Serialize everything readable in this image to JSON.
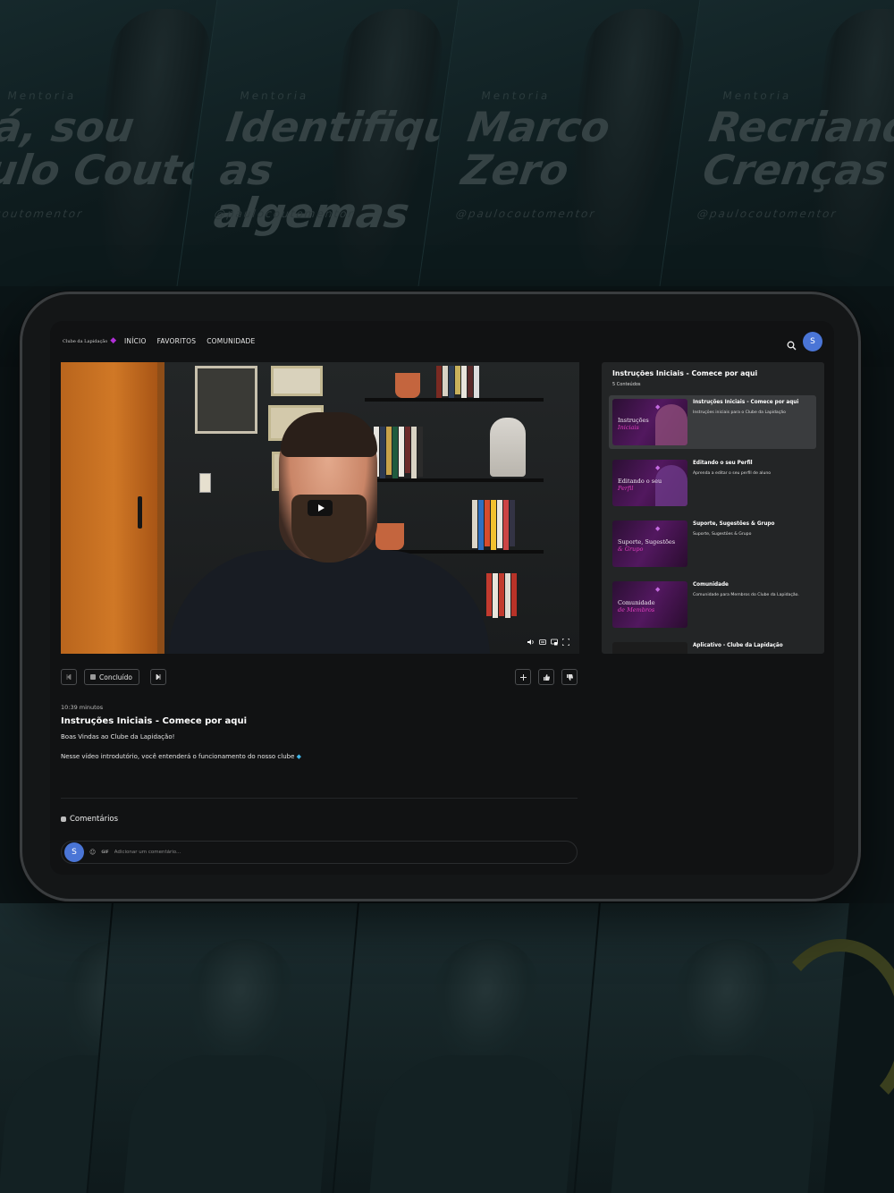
{
  "background": {
    "posters": [
      {
        "kicker": "Mentoria",
        "line1": "á, sou",
        "line2": "ulo Couto",
        "handle": "@coutomentor"
      },
      {
        "kicker": "Mentoria",
        "line1": "Identifique",
        "line2": "as algemas",
        "handle": "@paulocoutomentor"
      },
      {
        "kicker": "Mentoria",
        "line1": "Marco",
        "line2": "Zero",
        "handle": "@paulocoutomentor"
      },
      {
        "kicker": "Mentoria",
        "line1": "Recriando",
        "line2": "Crenças",
        "handle": "@paulocoutomentor"
      }
    ]
  },
  "nav": {
    "logo_text": "Clube da Lapidação",
    "links": [
      "INÍCIO",
      "FAVORITOS",
      "COMUNIDADE"
    ],
    "avatar_letter": "S"
  },
  "actions": {
    "done_label": "Concluído"
  },
  "lesson": {
    "duration": "10:39 minutos",
    "title": "Instruções Iniciais - Comece por aqui",
    "desc1": "Boas Vindas ao Clube da Lapidação!",
    "desc2": "Nesse vídeo introdutório, você entenderá o funcionamento do nosso clube"
  },
  "comments": {
    "heading": "Comentários",
    "avatar_letter": "S",
    "gif_label": "GIF",
    "placeholder": "Adicionar um comentário..."
  },
  "playlist": {
    "title": "Instruções Iniciais - Comece por aqui",
    "count": "5 Conteúdos",
    "items": [
      {
        "thumb1": "Instruções",
        "thumb2": "Iniciais",
        "title": "Instruções Iniciais - Comece por aqui",
        "desc": "Instruções iniciais para o Clube da Lapidação"
      },
      {
        "thumb1": "Editando o seu",
        "thumb2": "Perfil",
        "title": "Editando o seu Perfil",
        "desc": "Aprenda a editar o seu perfil de aluno"
      },
      {
        "thumb1": "Suporte, Sugestões",
        "thumb2": "& Grupo",
        "title": "Suporte, Sugestões & Grupo",
        "desc": "Suporte, Sugestões & Grupo"
      },
      {
        "thumb1": "Comunidade",
        "thumb2": "de Membros",
        "title": "Comunidade",
        "desc": "Comunidade para Membros do Clube da Lapidação."
      },
      {
        "thumb1": "",
        "thumb2": "",
        "title": "Aplicativo - Clube da Lapidação",
        "desc": ""
      }
    ]
  },
  "colors": {
    "avatar": "#4a75d6",
    "accent_purple": "#b02fd6",
    "gem_blue": "#3fb6ea"
  }
}
